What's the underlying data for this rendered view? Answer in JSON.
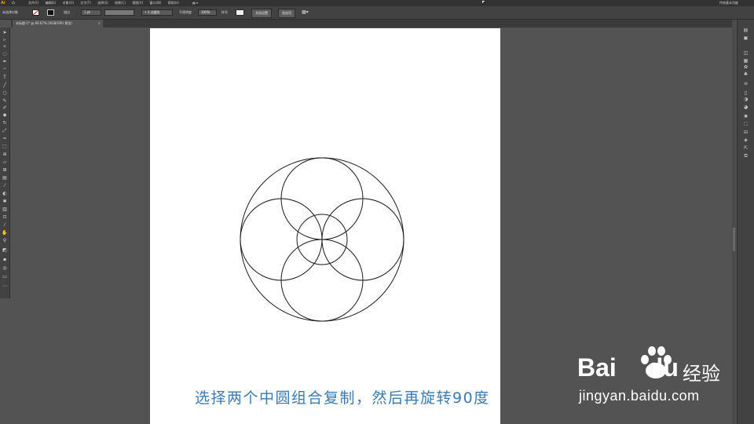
{
  "app": {
    "logo": "Ai"
  },
  "menubar": {
    "items": [
      "文件(F)",
      "编辑(E)",
      "对象(O)",
      "文字(T)",
      "选择(S)",
      "效果(C)",
      "视图(V)",
      "窗口(W)",
      "帮助(H)"
    ],
    "workspace": "▦ ▾",
    "user_label": "传统基本功能"
  },
  "controlbar": {
    "selection_label": "未选择对象",
    "stroke_label": "描边",
    "stroke_value": "1 pt",
    "brush_value": "• 3 点圆形",
    "opacity_label": "不透明度",
    "opacity_value": "100%",
    "style_label": "样式",
    "doc_setup_button": "文档设置",
    "prefs_button": "首选项"
  },
  "document_tab": {
    "title": "未标题-1* @ 66.67% (RGB/GPU 预览)",
    "close": "×"
  },
  "artwork": {
    "stroke_color": "#1a1a1a",
    "background": "#ffffff"
  },
  "caption": "选择两个中圆组合复制，然后再旋转90度",
  "watermark": {
    "brand": "Bai",
    "brand_suffix": "du",
    "cn": "经验",
    "url": "jingyan.baidu.com"
  }
}
